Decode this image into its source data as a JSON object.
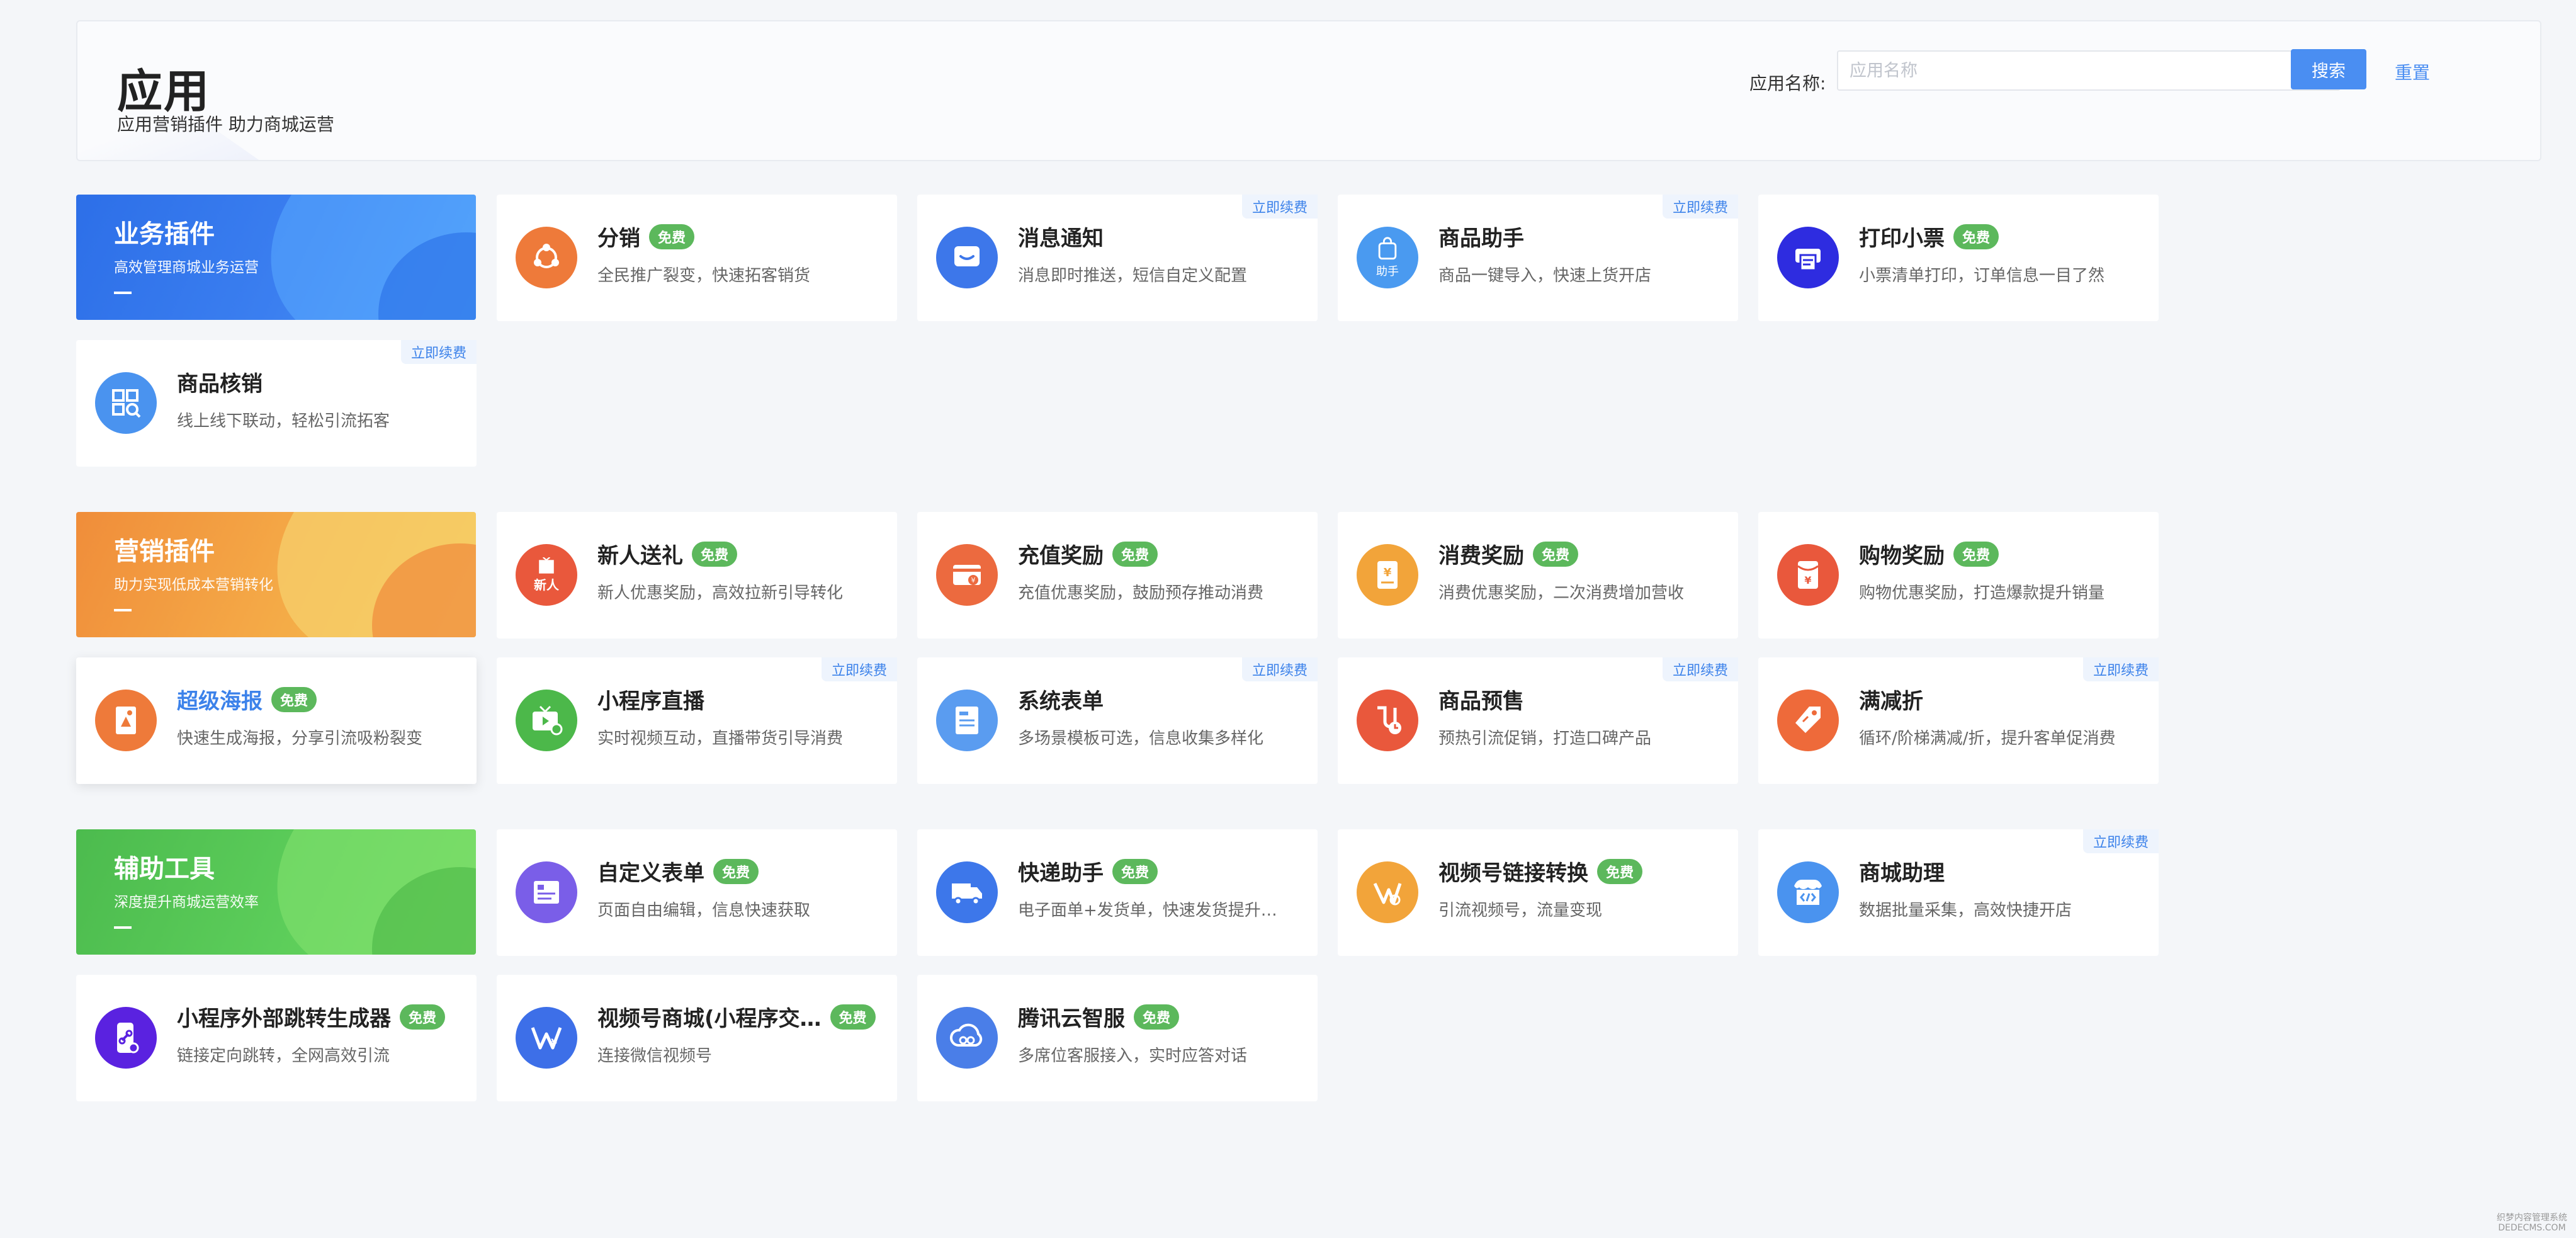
{
  "header": {
    "title": "应用",
    "subtitle": "应用营销插件 助力商城运营",
    "search_label": "应用名称:",
    "search_placeholder": "应用名称",
    "search_value": "",
    "search_button": "搜索",
    "reset_label": "重置"
  },
  "badges": {
    "free": "免费",
    "renew": "立即续费"
  },
  "categories": [
    {
      "title": "业务插件",
      "subtitle": "高效管理商城业务运营"
    },
    {
      "title": "营销插件",
      "subtitle": "助力实现低成本营销转化"
    },
    {
      "title": "辅助工具",
      "subtitle": "深度提升商城运营效率"
    }
  ],
  "cards": [
    {
      "name": "分销",
      "desc": "全民推广裂变，快速拓客销货",
      "icon": "share-network-icon",
      "color": "#ee7a3a"
    },
    {
      "name": "消息通知",
      "desc": "消息即时推送，短信自定义配置",
      "icon": "message-icon",
      "color": "#3d77ea"
    },
    {
      "name": "商品助手",
      "desc": "商品一键导入，快速上货开店",
      "icon": "shopping-bag-icon",
      "color": "#4a9af0",
      "icon_text": "助手"
    },
    {
      "name": "打印小票",
      "desc": "小票清单打印，订单信息一目了然",
      "icon": "printer-icon",
      "color": "#2e2ce0"
    },
    {
      "name": "商品核销",
      "desc": "线上线下联动，轻松引流拓客",
      "icon": "qr-scan-icon",
      "color": "#4a93ef"
    },
    {
      "name": "新人送礼",
      "desc": "新人优惠奖励，高效拉新引导转化",
      "icon": "gift-box-icon",
      "color": "#e9583c",
      "icon_text": "新人"
    },
    {
      "name": "充值奖励",
      "desc": "充值优惠奖励，鼓励预存推动消费",
      "icon": "wallet-icon",
      "color": "#ec6a3f"
    },
    {
      "name": "消费奖励",
      "desc": "消费优惠奖励，二次消费增加营收",
      "icon": "coupon-icon",
      "color": "#f2a43a"
    },
    {
      "name": "购物奖励",
      "desc": "购物优惠奖励，打造爆款提升销量",
      "icon": "red-envelope-icon",
      "color": "#e9583c"
    },
    {
      "name": "超级海报",
      "desc": "快速生成海报，分享引流吸粉裂变",
      "icon": "poster-icon",
      "color": "#ee7a3a"
    },
    {
      "name": "小程序直播",
      "desc": "实时视频互动，直播带货引导消费",
      "icon": "live-tv-icon",
      "color": "#4cb84a"
    },
    {
      "name": "系统表单",
      "desc": "多场景模板可选，信息收集多样化",
      "icon": "form-icon",
      "color": "#5a9cf0"
    },
    {
      "name": "商品预售",
      "desc": "预热引流促销，打造口碑产品",
      "icon": "presale-clock-icon",
      "color": "#e9583c"
    },
    {
      "name": "满减折",
      "desc": "循环/阶梯满减/折，提升客单促消费",
      "icon": "price-tag-icon",
      "color": "#ee6a3a"
    },
    {
      "name": "自定义表单",
      "desc": "页面自由编辑，信息快速获取",
      "icon": "custom-form-icon",
      "color": "#7a5ee8"
    },
    {
      "name": "快递助手",
      "desc": "电子面单+发货单，快速发货提升…",
      "icon": "delivery-truck-icon",
      "color": "#3d77ea"
    },
    {
      "name": "视频号链接转换",
      "desc": "引流视频号，流量变现",
      "icon": "video-channel-icon",
      "color": "#f2a43a"
    },
    {
      "name": "商城助理",
      "desc": "数据批量采集，高效快捷开店",
      "icon": "store-code-icon",
      "color": "#4a93ef"
    },
    {
      "name": "小程序外部跳转生成器",
      "desc": "链接定向跳转，全网高效引流",
      "icon": "phone-link-icon",
      "color": "#5a22e0"
    },
    {
      "name": "视频号商城(小程序交…",
      "desc": "连接微信视频号",
      "icon": "video-shop-icon",
      "color": "#3d6fe8"
    },
    {
      "name": "腾讯云智服",
      "desc": "多席位客服接入，实时应答对话",
      "icon": "cloud-service-icon",
      "color": "#4a7ee8"
    }
  ],
  "watermark": {
    "line1": "织梦内容管理系统",
    "line2": "DEDECMS.COM"
  }
}
